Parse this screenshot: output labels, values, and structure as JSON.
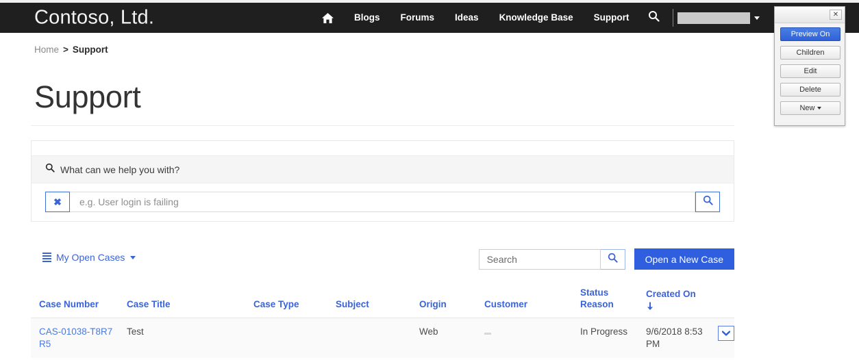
{
  "navbar": {
    "brand": "Contoso, Ltd.",
    "home_icon": "home-icon",
    "items": [
      {
        "label": "Blogs"
      },
      {
        "label": "Forums"
      },
      {
        "label": "Ideas"
      },
      {
        "label": "Knowledge Base"
      },
      {
        "label": "Support"
      }
    ],
    "search_icon": "search-icon",
    "user_caret_icon": "chevron-down-icon"
  },
  "breadcrumb": {
    "home": "Home",
    "separator": ">",
    "current": "Support"
  },
  "page": {
    "title": "Support"
  },
  "knowledge_search": {
    "heading": "What can we help you with?",
    "heading_icon": "search-icon",
    "clear_label": "✖",
    "input_value": "",
    "input_placeholder": "e.g. User login is failing",
    "submit_icon": "search-icon"
  },
  "toolbar": {
    "view_label": "My Open Cases",
    "view_icon": "list-icon",
    "view_caret_icon": "chevron-down-icon",
    "search_value": "",
    "search_placeholder": "Search",
    "search_icon": "search-icon",
    "new_case_label": "Open a New Case"
  },
  "cases_table": {
    "columns": [
      {
        "label": "Case Number",
        "sorted": false
      },
      {
        "label": "Case Title",
        "sorted": false
      },
      {
        "label": "Case Type",
        "sorted": false
      },
      {
        "label": "Subject",
        "sorted": false
      },
      {
        "label": "Origin",
        "sorted": false
      },
      {
        "label": "Customer",
        "sorted": false
      },
      {
        "label": "Status Reason",
        "sorted": false
      },
      {
        "label": "Created On",
        "sorted": true,
        "sort_direction": "desc",
        "sort_icon": "arrow-down-icon"
      }
    ],
    "rows": [
      {
        "case_number": "CAS-01038-T8R7R5",
        "case_title": "Test",
        "case_type": "",
        "subject": "",
        "origin": "Web",
        "customer": "",
        "status_reason": "In Progress",
        "created_on": "9/6/2018 8:53 PM",
        "row_action_icon": "chevron-down-icon"
      }
    ]
  },
  "admin_panel": {
    "close_label": "✕",
    "buttons": [
      {
        "label": "Preview On",
        "active": true
      },
      {
        "label": "Children",
        "active": false
      },
      {
        "label": "Edit",
        "active": false
      },
      {
        "label": "Delete",
        "active": false
      },
      {
        "label": "New",
        "active": false,
        "has_caret": true
      }
    ]
  },
  "colors": {
    "navbar_bg": "#1f1f1f",
    "accent_blue": "#2f5ede",
    "link_blue": "#3a63d6",
    "panel_bg": "#f5f5f5",
    "row_bg": "#fafafa"
  }
}
